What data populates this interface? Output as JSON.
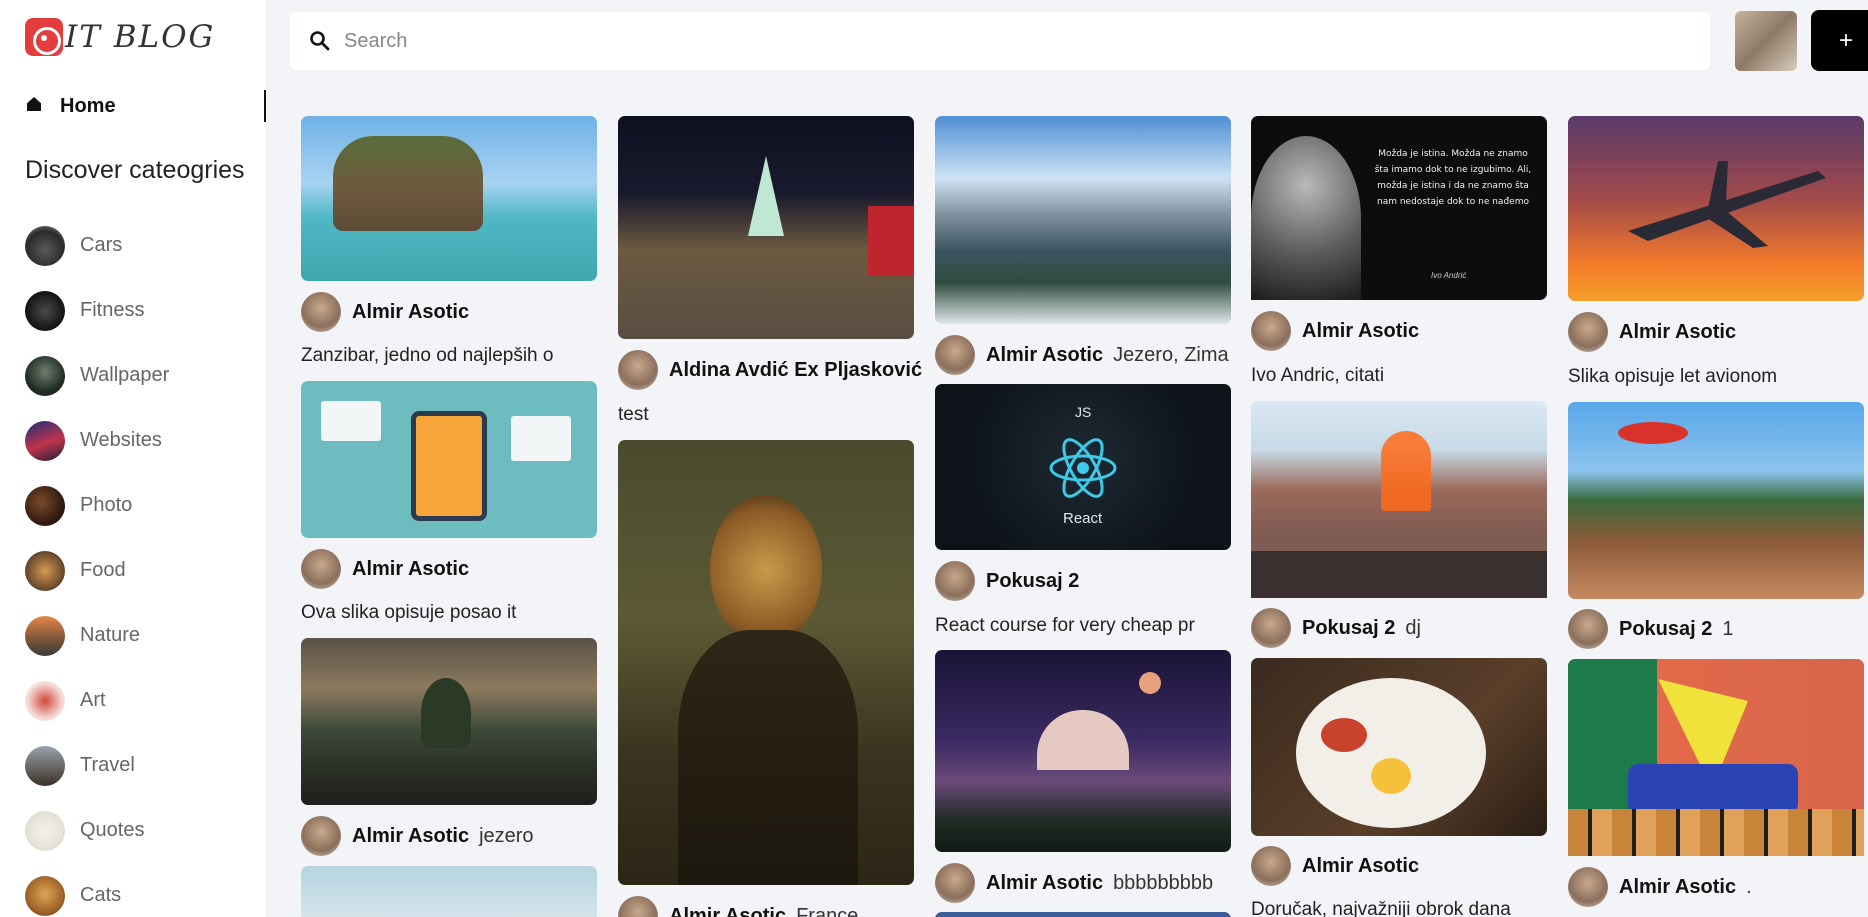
{
  "logo": {
    "text": "IT BLOG",
    "accent": "#e43d3d"
  },
  "nav": {
    "home_label": "Home"
  },
  "discover": {
    "title": "Discover cateogries",
    "categories": [
      {
        "label": "Cars",
        "icon": "cars-thumb"
      },
      {
        "label": "Fitness",
        "icon": "fitness-thumb"
      },
      {
        "label": "Wallpaper",
        "icon": "wallpaper-thumb"
      },
      {
        "label": "Websites",
        "icon": "websites-thumb"
      },
      {
        "label": "Photo",
        "icon": "photo-thumb"
      },
      {
        "label": "Food",
        "icon": "food-thumb"
      },
      {
        "label": "Nature",
        "icon": "nature-thumb"
      },
      {
        "label": "Art",
        "icon": "art-thumb"
      },
      {
        "label": "Travel",
        "icon": "travel-thumb"
      },
      {
        "label": "Quotes",
        "icon": "quotes-thumb"
      },
      {
        "label": "Cats",
        "icon": "cats-thumb"
      }
    ]
  },
  "search": {
    "placeholder": "Search",
    "value": ""
  },
  "header": {
    "add_label": "+"
  },
  "pins": [
    {
      "author": "Almir Asotic",
      "tag": "",
      "caption": "Zanzibar, jedno od najlepših o"
    },
    {
      "author": "Almir Asotic",
      "tag": "",
      "caption": "Ova slika opisuje posao it"
    },
    {
      "author": "Almir Asotic",
      "tag": "jezero",
      "caption": ""
    },
    {
      "author": "",
      "tag": "",
      "caption": ""
    },
    {
      "author": "Aldina Avdić Ex Pljasković",
      "tag": "",
      "caption": "test"
    },
    {
      "author": "Almir Asotic",
      "tag": "France",
      "caption": ""
    },
    {
      "author": "Almir Asotic",
      "tag": "Jezero, Zima",
      "caption": ""
    },
    {
      "author": "Pokusaj 2",
      "tag": "",
      "caption": "React course for very cheap pr"
    },
    {
      "author": "Almir Asotic",
      "tag": "bbbbbbbbb",
      "caption": ""
    },
    {
      "author": "Almir Asotic",
      "tag": "",
      "caption": "Ivo Andric, citati"
    },
    {
      "author": "Pokusaj 2",
      "tag": "dj",
      "caption": ""
    },
    {
      "author": "Almir Asotic",
      "tag": "",
      "caption": "Doručak, najvažniji obrok dana"
    },
    {
      "author": "Almir Asotic",
      "tag": "",
      "caption": "Slika opisuje let avionom"
    },
    {
      "author": "Pokusaj 2",
      "tag": "1",
      "caption": ""
    },
    {
      "author": "Almir Asotic",
      "tag": ".",
      "caption": ""
    }
  ],
  "image_text": {
    "quote": "Možda je istina. Možda ne znamo šta imamo dok to ne izgubimo. Ali, možda je istina i da ne znamo šta nam nedostaje dok to ne nađemo",
    "quote_author": "Ivo Andrić",
    "react_label": "React",
    "js_label": "JS"
  }
}
